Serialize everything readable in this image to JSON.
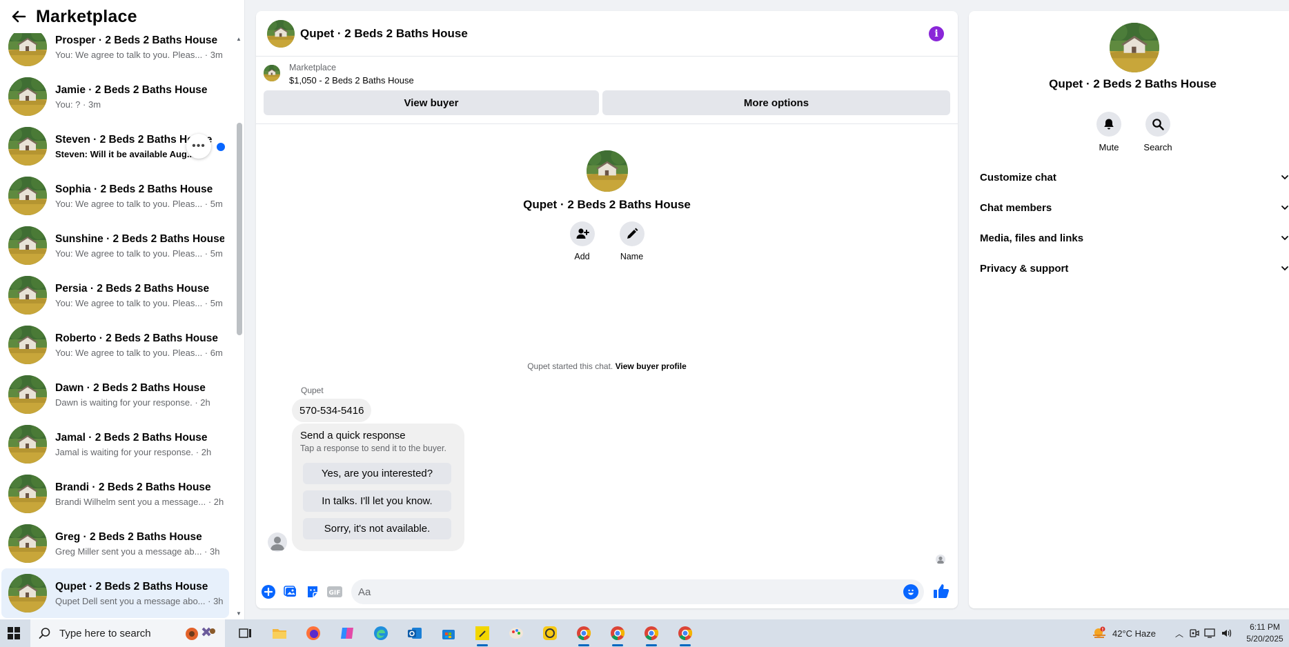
{
  "sidebar": {
    "title": "Marketplace",
    "conversations": [
      {
        "name": "Prosper · 2 Beds 2 Baths House",
        "snippet": "You: We agree to talk to you. Pleas...",
        "time": "3m"
      },
      {
        "name": "Jamie · 2 Beds 2 Baths House",
        "snippet": "You: ?",
        "time": "3m"
      },
      {
        "name": "Steven · 2 Beds 2 Baths House",
        "snippet": "Steven: Will it be available Aug...",
        "time": "",
        "unread": true
      },
      {
        "name": "Sophia · 2 Beds 2 Baths House",
        "snippet": "You: We agree to talk to you. Pleas...",
        "time": "5m"
      },
      {
        "name": "Sunshine · 2 Beds 2 Baths House",
        "snippet": "You: We agree to talk to you. Pleas...",
        "time": "5m"
      },
      {
        "name": "Persia · 2 Beds 2 Baths House",
        "snippet": "You: We agree to talk to you. Pleas...",
        "time": "5m"
      },
      {
        "name": "Roberto · 2 Beds 2 Baths House",
        "snippet": "You: We agree to talk to you. Pleas...",
        "time": "6m"
      },
      {
        "name": "Dawn · 2 Beds 2 Baths House",
        "snippet": "Dawn is waiting for your response.",
        "time": "2h"
      },
      {
        "name": "Jamal · 2 Beds 2 Baths House",
        "snippet": "Jamal is waiting for your response.",
        "time": "2h"
      },
      {
        "name": "Brandi · 2 Beds 2 Baths House",
        "snippet": "Brandi Wilhelm sent you a message...",
        "time": "2h"
      },
      {
        "name": "Greg · 2 Beds 2 Baths House",
        "snippet": "Greg Miller sent you a message ab...",
        "time": "3h"
      },
      {
        "name": "Qupet · 2 Beds 2 Baths House",
        "snippet": "Qupet Dell sent you a message abo...",
        "time": "3h",
        "active": true
      }
    ]
  },
  "chat": {
    "title": "Qupet · 2 Beds 2 Baths House",
    "marketplace_label": "Marketplace",
    "listing": "$1,050 - 2 Beds 2 Baths House",
    "view_buyer": "View buyer",
    "more_options": "More options",
    "intro_name": "Qupet · 2 Beds 2 Baths House",
    "add_label": "Add",
    "name_label": "Name",
    "started_text": "Qupet started this chat.",
    "view_buyer_profile": "View buyer profile",
    "sender": "Qupet",
    "phone_message": "570-534-5416",
    "quick_title": "Send a quick response",
    "quick_sub": "Tap a response to send it to the buyer.",
    "quick_replies": [
      "Yes, are you interested?",
      "In talks. I'll let you know.",
      "Sorry, it's not available."
    ],
    "input_placeholder": "Aa"
  },
  "info_panel": {
    "name": "Qupet · 2 Beds 2 Baths House",
    "mute": "Mute",
    "search": "Search",
    "sections": [
      "Customize chat",
      "Chat members",
      "Media, files and links",
      "Privacy & support"
    ]
  },
  "taskbar": {
    "search_placeholder": "Type here to search",
    "weather": "42°C  Haze",
    "time": "6:11 PM",
    "date": "5/20/2025"
  },
  "colors": {
    "accent": "#0866ff",
    "info": "#8a26d8",
    "active_row": "#e7f0fb"
  }
}
